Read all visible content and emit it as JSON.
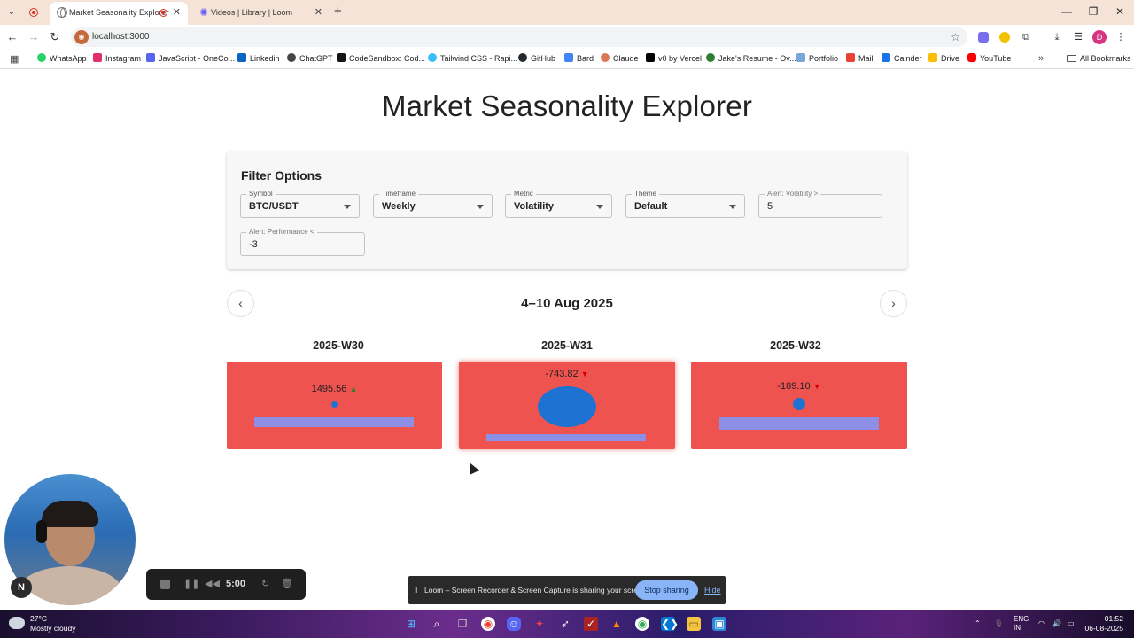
{
  "browser": {
    "tabs": [
      {
        "title": "Market Seasonality Explorer",
        "active": true
      },
      {
        "title": "Videos | Library | Loom",
        "active": false
      }
    ],
    "url": "localhost:3000",
    "bookmarks": [
      "WhatsApp",
      "Instagram",
      "JavaScript - OneCo...",
      "Linkedin",
      "ChatGPT",
      "CodeSandbox: Cod...",
      "Tailwind CSS - Rapi...",
      "GitHub",
      "Bard",
      "Claude",
      "v0 by Vercel",
      "Jake's Resume - Ov...",
      "Portfolio",
      "Mail",
      "Calnder",
      "Drive",
      "YouTube"
    ],
    "all_bookmarks": "All Bookmarks",
    "profile_initial": "D"
  },
  "page": {
    "title": "Market Seasonality Explorer",
    "filter": {
      "heading": "Filter Options",
      "symbol": {
        "label": "Symbol",
        "value": "BTC/USDT"
      },
      "timeframe": {
        "label": "Timeframe",
        "value": "Weekly"
      },
      "metric": {
        "label": "Metric",
        "value": "Volatility"
      },
      "theme": {
        "label": "Theme",
        "value": "Default"
      },
      "alert_volatility": {
        "label": "Alert: Volatility >",
        "value": "5"
      },
      "alert_performance": {
        "label": "Alert: Performance <",
        "value": "-3"
      }
    },
    "date_range": "4–10 Aug 2025",
    "weeks": [
      {
        "label": "2025-W30",
        "value": "1495.56",
        "direction": "up",
        "arrow": "▲"
      },
      {
        "label": "2025-W31",
        "value": "-743.82",
        "direction": "down",
        "arrow": "▼"
      },
      {
        "label": "2025-W32",
        "value": "-189.10",
        "direction": "down",
        "arrow": "▼"
      }
    ],
    "card_color": "#ef5350",
    "circle_color": "#1e73d2",
    "bar_color": "#8c8fe3"
  },
  "loom": {
    "badge": "N",
    "timer": "5:00",
    "share_message": "Loom – Screen Recorder & Screen Capture is sharing your screen.",
    "stop_sharing": "Stop sharing",
    "hide": "Hide"
  },
  "taskbar": {
    "temperature": "27°C",
    "weather": "Mostly cloudy",
    "language_line1": "ENG",
    "language_line2": "IN",
    "time": "01:52",
    "date": "06-08-2025"
  }
}
